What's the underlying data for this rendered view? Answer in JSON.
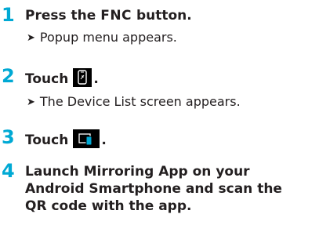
{
  "steps": [
    {
      "number": "1",
      "instruction_prefix": "Press the ",
      "instruction_key": "FNC",
      "instruction_suffix": " button.",
      "result_arrow": "➤",
      "result": "Popup menu appears."
    },
    {
      "number": "2",
      "instruction_prefix": "Touch",
      "icon": "device-list-icon",
      "instruction_suffix": ".",
      "result_arrow": "➤",
      "result": "The Device List screen appears."
    },
    {
      "number": "3",
      "instruction_prefix": "Touch",
      "icon": "mirroring-connect-icon",
      "instruction_suffix": "."
    },
    {
      "number": "4",
      "instruction": "Launch Mirroring App on your Android Smartphone and scan the QR code with the app."
    }
  ],
  "colors": {
    "step_number": "#00a9d4",
    "icon_background": "#000000",
    "icon_accent": "#00a9d4",
    "text": "#231f20"
  }
}
